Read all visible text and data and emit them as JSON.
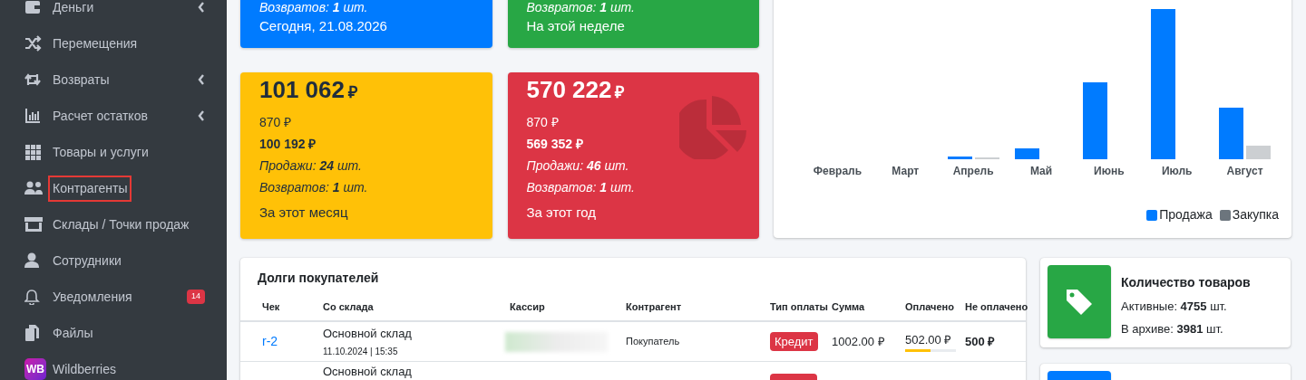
{
  "sidebar": {
    "items": [
      {
        "label": "Деньги",
        "has_submenu": true,
        "highlighted": false
      },
      {
        "label": "Перемещения",
        "has_submenu": false,
        "highlighted": false
      },
      {
        "label": "Возвраты",
        "has_submenu": true,
        "highlighted": false
      },
      {
        "label": "Расчет остатков",
        "has_submenu": true,
        "highlighted": false
      },
      {
        "label": "Товары и услуги",
        "has_submenu": false,
        "highlighted": false
      },
      {
        "label": "Контрагенты",
        "has_submenu": false,
        "highlighted": true
      },
      {
        "label": "Склады / Точки продаж",
        "has_submenu": false,
        "highlighted": false
      },
      {
        "label": "Сотрудники",
        "has_submenu": false,
        "highlighted": false
      },
      {
        "label": "Уведомления",
        "has_submenu": false,
        "highlighted": false,
        "badge": "14"
      },
      {
        "label": "Файлы",
        "has_submenu": false,
        "highlighted": false
      },
      {
        "label": "Wildberries",
        "logo_text": "WB",
        "has_submenu": false,
        "highlighted": false
      }
    ]
  },
  "stat_cards": [
    {
      "color": "#007bff",
      "dark_text": false,
      "lines": [
        "Возвратов: **1** шт."
      ],
      "period": "Сегодня, 21.08.2026"
    },
    {
      "color": "#28a745",
      "dark_text": false,
      "lines": [
        "Возвратов: **1** шт."
      ],
      "period": "На этой неделе"
    },
    {
      "color": "#ffc107",
      "dark_text": true,
      "total": "101 062",
      "currency": "₽",
      "amount_1": "870 ₽",
      "amount_2": "100 192 ₽",
      "lines": [
        "Продажи: **24** шт.",
        "Возвратов: **1** шт."
      ],
      "period": "За этот месяц"
    },
    {
      "color": "#dc3545",
      "dark_text": false,
      "total": "570 222",
      "currency": "₽",
      "amount_1": "870 ₽",
      "amount_2": "569 352 ₽",
      "lines": [
        "Продажи: **46** шт.",
        "Возвратов: **1** шт."
      ],
      "period": "За этот год"
    }
  ],
  "sales_chart": {
    "months": [
      "Февраль",
      "Март",
      "Апрель",
      "Май",
      "Июнь",
      "Июль",
      "Август"
    ],
    "legend": [
      {
        "label": "Продажа",
        "color": "#007bff"
      },
      {
        "label": "Закупка",
        "color": "#6c757d"
      }
    ]
  },
  "debts": {
    "title": "Долги покупателей",
    "columns": [
      "Чек",
      "Со склада",
      "Кассир",
      "Контрагент",
      "Тип оплаты",
      "Сумма",
      "Оплачено",
      "Не оплачено"
    ],
    "rows": [
      {
        "check": "r-2",
        "warehouse": "Основной склад",
        "datetime": "11.10.2024 | 15:35",
        "counterparty": "Покупатель",
        "payment_type": "Кредит",
        "sum": "1002.00 ₽",
        "paid": "502.00 ₽",
        "level": 0.5,
        "unpaid": "500 ₽"
      },
      {
        "warehouse": "Основной склад"
      }
    ]
  },
  "info_cards": [
    {
      "color": "#28a745",
      "title": "Количество товаров",
      "lines": [
        "Активные: **4755** шт.",
        "В архиве: **3981** шт."
      ]
    },
    {
      "color": "#007bff"
    }
  ]
}
